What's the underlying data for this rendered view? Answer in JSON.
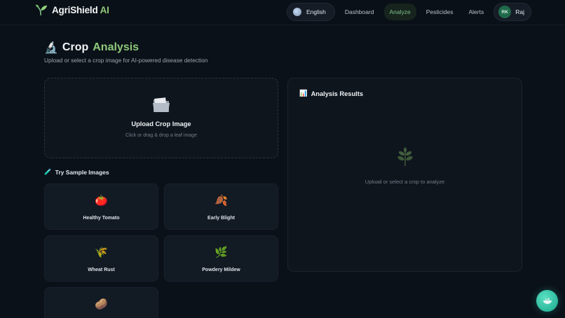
{
  "app": {
    "brand_main": "AgriShield",
    "brand_suffix": " AI"
  },
  "nav": {
    "language": "English",
    "links": [
      "Dashboard",
      "Analyze",
      "Pesticides",
      "Alerts"
    ],
    "active_link": "Analyze",
    "user_initials": "RK",
    "user_name": "Raj"
  },
  "page": {
    "title_icon": "🔬",
    "title_main": "Crop",
    "title_accent": "Analysis",
    "subtitle": "Upload or select a crop image for AI-powered disease detection"
  },
  "upload": {
    "icon": "folder-icon",
    "title": "Upload Crop Image",
    "hint": "Click or drag & drop a leaf image"
  },
  "samples": {
    "title_icon": "🧪",
    "title": "Try Sample Images",
    "items": [
      {
        "emoji": "🍅",
        "label": "Healthy Tomato"
      },
      {
        "emoji": "🍂",
        "label": "Early Blight"
      },
      {
        "emoji": "🌾",
        "label": "Wheat Rust"
      },
      {
        "emoji": "🌿",
        "label": "Powdery Mildew"
      },
      {
        "emoji": "🥔",
        "label": ""
      }
    ]
  },
  "results": {
    "title_icon": "📊",
    "title": "Analysis Results",
    "empty_text": "Upload or select a crop to analyze"
  },
  "colors": {
    "accent": "#8fc97a",
    "active_nav_bg": "#17241d",
    "fab": "#2cc7a6"
  }
}
